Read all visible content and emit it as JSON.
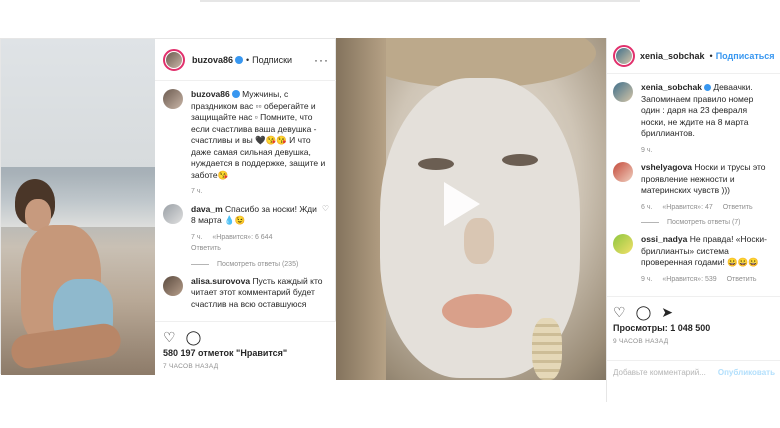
{
  "left_post": {
    "username": "buzova86",
    "follow_label": "Подписки",
    "caption": {
      "username": "buzova86",
      "text": "Мужчины, с праздником вас ▫▫ оберегайте и защищайте нас ▫ Помните, что если счастлива ваша девушка - счастливы и вы 🖤😘😘 И что даже самая сильная девушка, нуждается в поддержке, защите и заботе😘",
      "time": "7 ч."
    },
    "comments": [
      {
        "username": "dava_m",
        "text": "Спасибо за носки! Жди 8 марта 💧😉",
        "time": "7 ч.",
        "likes": "«Нравится»: 6 644",
        "reply": "Ответить",
        "view_replies": "Посмотреть ответы (235)"
      },
      {
        "username": "alisa.surovova",
        "text": "Пусть каждый кто читает этот комментарий будет счастлив на всю оставшуюся"
      }
    ],
    "likes": "580 197 отметок \"Нравится\"",
    "posted_ago": "7 ЧАСОВ НАЗАД"
  },
  "right_post": {
    "username": "xenia_sobchak",
    "follow_label": "Подписаться",
    "caption": {
      "username": "xenia_sobchak",
      "text": "Деваачки. Запоминаем правило номер один : даря на 23 февраля носки, не ждите на 8 марта бриллиантов.",
      "time": "9 ч."
    },
    "comments": [
      {
        "username": "vshelyagova",
        "text": "Носки и трусы это проявление нежности и материнских чувств )))",
        "time": "6 ч.",
        "likes": "«Нравится»: 47",
        "reply": "Ответить",
        "view_replies": "Посмотреть ответы (7)"
      },
      {
        "username": "ossi_nadya",
        "text": "Не правда! «Носки-бриллианты» система проверенная годами! 😀😀😀",
        "time": "9 ч.",
        "likes": "«Нравится»: 539",
        "reply": "Ответить"
      }
    ],
    "views": "Просмотры: 1 048 500",
    "posted_ago": "9 ЧАСОВ НАЗАД",
    "add_comment_placeholder": "Добавьте комментарий...",
    "publish_label": "Опубликовать"
  },
  "icons": {
    "like": "heart-icon",
    "comment": "comment-icon",
    "share": "share-icon",
    "save": "bookmark-icon",
    "more": "more-icon",
    "play": "play-icon"
  },
  "colors": {
    "link_blue": "#3897f0",
    "text": "#262626",
    "muted": "#8e8e8e"
  }
}
